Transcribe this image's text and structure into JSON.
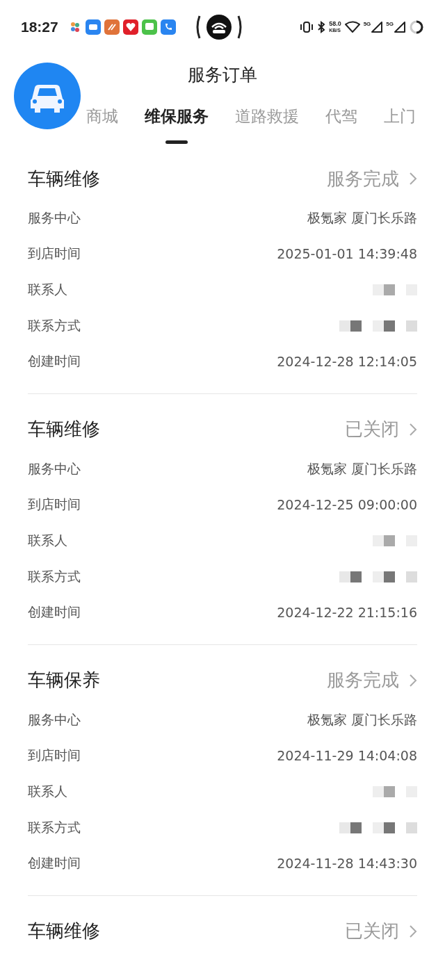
{
  "status_bar": {
    "time": "18:27",
    "speed": "58.0",
    "speed_unit": "KB/S",
    "sim1": "5G",
    "sim2": "5G"
  },
  "header": {
    "title": "服务订单"
  },
  "tabs": [
    {
      "label": "商城",
      "selected": false
    },
    {
      "label": "维保服务",
      "selected": true
    },
    {
      "label": "道路救援",
      "selected": false
    },
    {
      "label": "代驾",
      "selected": false
    },
    {
      "label": "上门",
      "selected": false
    }
  ],
  "orders": [
    {
      "title": "车辆维修",
      "status": "服务完成",
      "fields": [
        {
          "kind": "text",
          "label": "服务中心",
          "value": "极氪家 厦门长乐路"
        },
        {
          "kind": "text",
          "label": "到店时间",
          "value": "2025-01-01 14:39:48"
        },
        {
          "kind": "blurred",
          "label": "联系人"
        },
        {
          "kind": "blurred",
          "label": "联系方式"
        },
        {
          "kind": "text",
          "label": "创建时间",
          "value": "2024-12-28 12:14:05"
        }
      ]
    },
    {
      "title": "车辆维修",
      "status": "已关闭",
      "fields": [
        {
          "kind": "text",
          "label": "服务中心",
          "value": "极氪家 厦门长乐路"
        },
        {
          "kind": "text",
          "label": "到店时间",
          "value": "2024-12-25 09:00:00"
        },
        {
          "kind": "blurred",
          "label": "联系人"
        },
        {
          "kind": "blurred",
          "label": "联系方式"
        },
        {
          "kind": "text",
          "label": "创建时间",
          "value": "2024-12-22 21:15:16"
        }
      ]
    },
    {
      "title": "车辆保养",
      "status": "服务完成",
      "fields": [
        {
          "kind": "text",
          "label": "服务中心",
          "value": "极氪家 厦门长乐路"
        },
        {
          "kind": "text",
          "label": "到店时间",
          "value": "2024-11-29 14:04:08"
        },
        {
          "kind": "blurred",
          "label": "联系人"
        },
        {
          "kind": "blurred",
          "label": "联系方式"
        },
        {
          "kind": "text",
          "label": "创建时间",
          "value": "2024-11-28 14:43:30"
        }
      ]
    },
    {
      "title": "车辆维修",
      "status": "已关闭"
    }
  ]
}
